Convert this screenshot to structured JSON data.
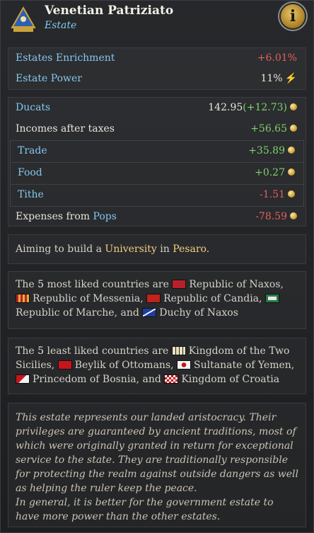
{
  "header": {
    "title": "Venetian Patriziato",
    "subtitle": "Estate",
    "info_icon_label": "i"
  },
  "stats": {
    "enrichment_label": "Estates Enrichment",
    "enrichment_value": "+6.01%",
    "power_label": "Estate Power",
    "power_value": "11%"
  },
  "finance": {
    "ducats_label": "Ducats",
    "ducats_value": "142.95",
    "ducats_change": "(+12.73)",
    "incomes_label": "Incomes after taxes",
    "incomes_value": "+56.65",
    "items": [
      {
        "label": "Trade",
        "value": "+35.89"
      },
      {
        "label": "Food",
        "value": "+0.27"
      },
      {
        "label": "Tithe",
        "value": "-1.51"
      }
    ],
    "expenses_prefix": "Expenses from ",
    "expenses_link": "Pops",
    "expenses_value": "-78.59"
  },
  "aim": {
    "prefix": "Aiming to build a ",
    "building": "University",
    "middle": " in ",
    "location": "Pesaro",
    "suffix": "."
  },
  "liked": {
    "prefix": "The ",
    "count": "5",
    "middle": " most liked countries are ",
    "countries": [
      "Republic of Naxos,",
      "Republic of Messenia,",
      "Republic of Candia,",
      "Republic of Marche,",
      "Duchy of Naxos"
    ],
    "and": " and "
  },
  "disliked": {
    "prefix": "The ",
    "count": "5",
    "middle": " least liked countries are ",
    "countries": [
      "Kingdom of the Two Sicilies,",
      "Beylik of Ottomans,",
      "Sultanate of Yemen,",
      "Princedom of Bosnia,",
      "Kingdom of Croatia"
    ],
    "and": " and "
  },
  "description": {
    "p1": "This estate represents our landed aristocracy. Their privileges are guaranteed by ancient traditions, most of which were originally granted in return for exceptional service to the state. They are traditionally responsible for protecting the realm against outside dangers as well as helping the ruler keep the peace.",
    "p2": "In general, it is better for the government estate to have more power than the other estates."
  },
  "colors": {
    "accent_blue": "#86c7ef",
    "positive": "#7fd36b",
    "negative": "#e5605d",
    "gold": "#f0d080"
  }
}
